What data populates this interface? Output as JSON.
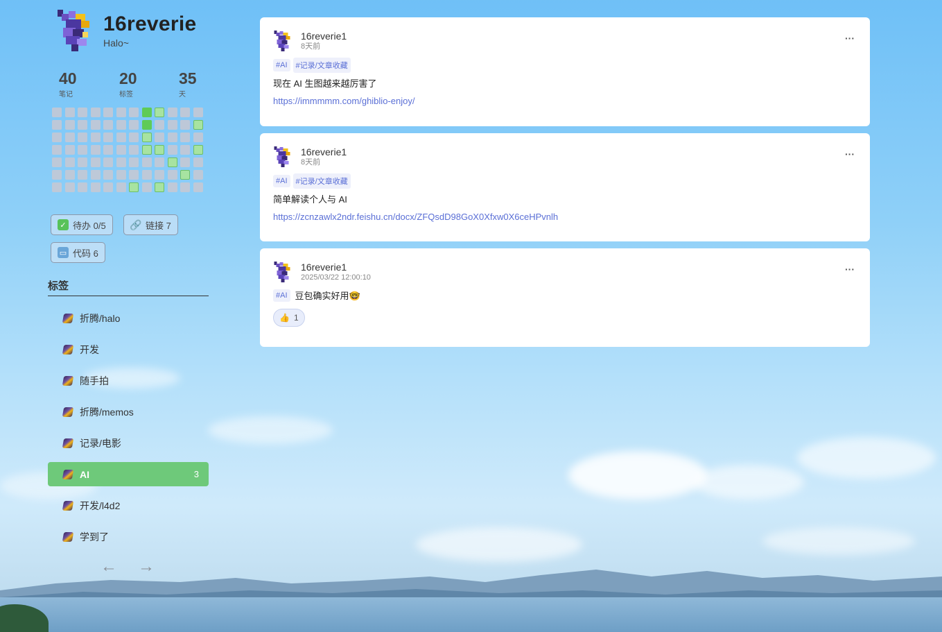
{
  "profile": {
    "name": "16reverie",
    "description": "Halo~"
  },
  "stats": [
    {
      "value": "40",
      "label": "笔记"
    },
    {
      "value": "20",
      "label": "标签"
    },
    {
      "value": "35",
      "label": "天"
    }
  ],
  "heatmap_levels": [
    [
      0,
      0,
      0,
      0,
      0,
      0,
      0,
      2,
      1,
      0,
      0,
      0
    ],
    [
      0,
      0,
      0,
      0,
      0,
      0,
      0,
      2,
      0,
      0,
      0,
      1
    ],
    [
      0,
      0,
      0,
      0,
      0,
      0,
      0,
      1,
      0,
      0,
      0,
      0
    ],
    [
      0,
      0,
      0,
      0,
      0,
      0,
      0,
      1,
      1,
      0,
      0,
      1
    ],
    [
      0,
      0,
      0,
      0,
      0,
      0,
      0,
      0,
      0,
      1,
      0,
      0
    ],
    [
      0,
      0,
      0,
      0,
      0,
      0,
      0,
      0,
      0,
      0,
      1,
      0
    ],
    [
      0,
      0,
      0,
      0,
      0,
      0,
      1,
      0,
      1,
      0,
      0,
      0
    ]
  ],
  "chips": {
    "todo": {
      "label": "待办 0/5",
      "icon": "checkbox-icon",
      "color": "#58c25a"
    },
    "links": {
      "label": "链接 7",
      "icon": "link-icon"
    },
    "code": {
      "label": "代码 6",
      "icon": "computer-icon"
    }
  },
  "tags_section": {
    "heading": "标签",
    "items": [
      {
        "label": "折腾/halo",
        "count": ""
      },
      {
        "label": "开发",
        "count": ""
      },
      {
        "label": "随手拍",
        "count": ""
      },
      {
        "label": "折腾/memos",
        "count": ""
      },
      {
        "label": "记录/电影",
        "count": ""
      },
      {
        "label": "AI",
        "count": "3",
        "active": true
      },
      {
        "label": "开发/l4d2",
        "count": ""
      },
      {
        "label": "学到了",
        "count": ""
      }
    ],
    "prev": "←",
    "next": "→"
  },
  "posts": [
    {
      "author": "16reverie1",
      "time": "8天前",
      "tags": [
        "#AI",
        "#记录/文章收藏"
      ],
      "content": "现在 AI 生图越来越厉害了",
      "link": "https://immmmm.com/ghiblio-enjoy/",
      "more": "···"
    },
    {
      "author": "16reverie1",
      "time": "8天前",
      "tags": [
        "#AI",
        "#记录/文章收藏"
      ],
      "content": "简单解读个人与 AI",
      "link": "https://zcnzawlx2ndr.feishu.cn/docx/ZFQsdD98GoX0Xfxw0X6ceHPvnlh",
      "more": "···"
    },
    {
      "author": "16reverie1",
      "time": "2025/03/22 12:00:10",
      "tags": [
        "#AI"
      ],
      "content": "豆包确实好用🤓",
      "reaction": {
        "emoji": "👍",
        "count": "1"
      },
      "more": "···"
    }
  ],
  "colors": {
    "accent_green": "#6ec97a",
    "link_blue": "#5a6fd6",
    "heat_high": "#5fcb57",
    "heat_low": "#a7e3a1"
  }
}
